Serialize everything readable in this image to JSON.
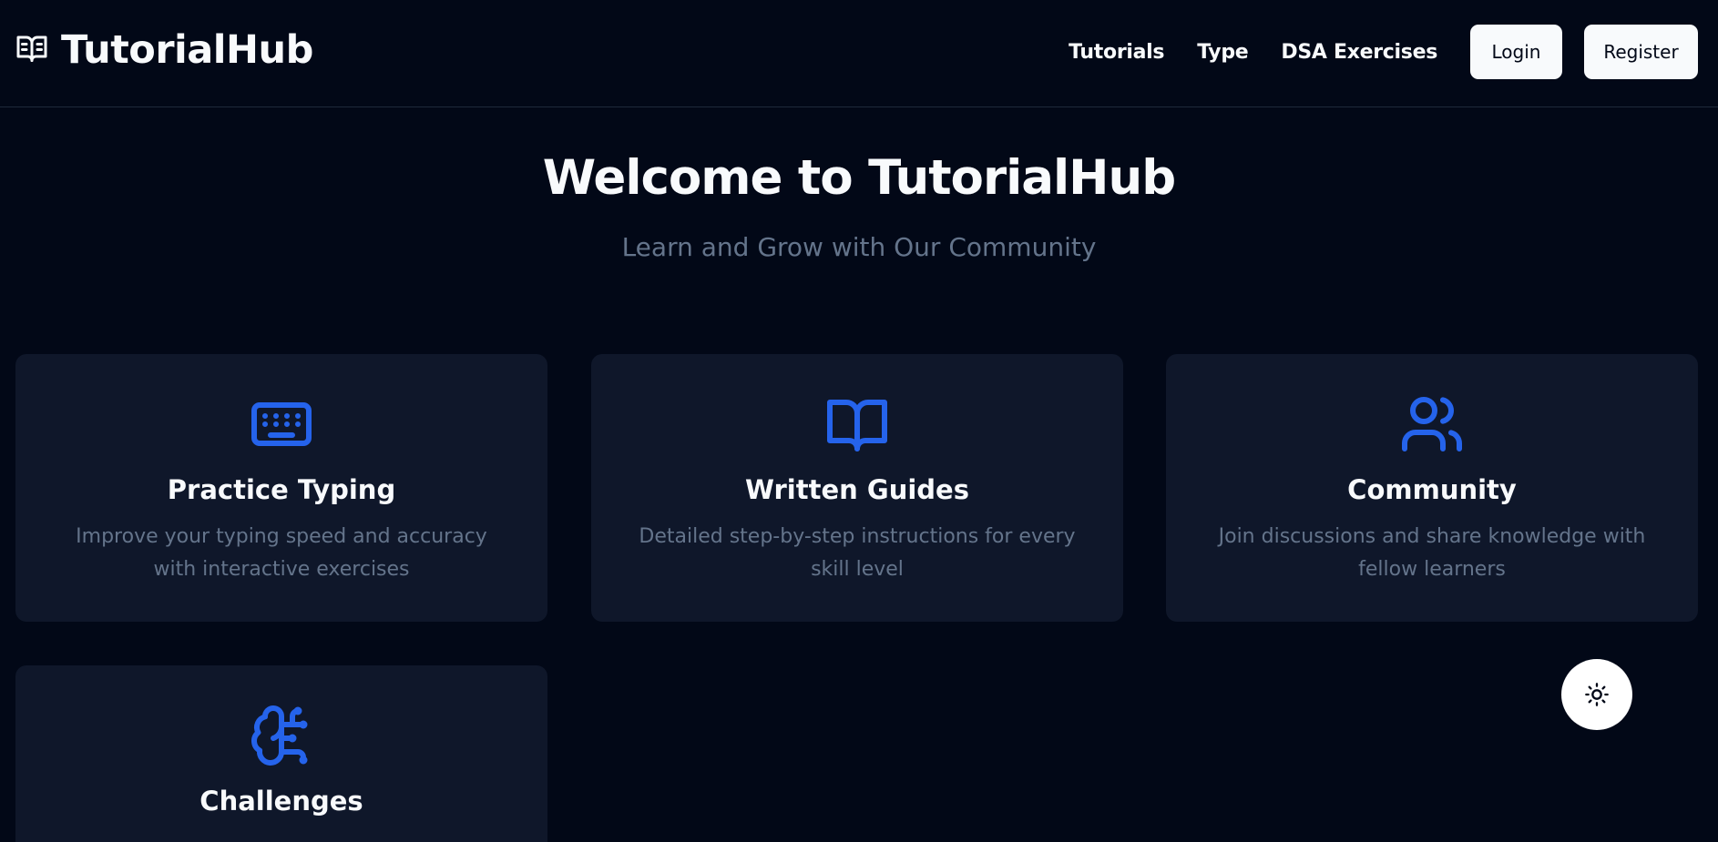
{
  "brand": {
    "icon": "book-open-icon",
    "name": "TutorialHub"
  },
  "nav": {
    "links": [
      "Tutorials",
      "Type",
      "DSA Exercises"
    ],
    "login_label": "Login",
    "register_label": "Register"
  },
  "hero": {
    "title": "Welcome to TutorialHub",
    "subtitle": "Learn and Grow with Our Community"
  },
  "features": [
    {
      "icon": "keyboard-icon",
      "title": "Practice Typing",
      "description": "Improve your typing speed and accuracy with interactive exercises"
    },
    {
      "icon": "book-open-icon",
      "title": "Written Guides",
      "description": "Detailed step-by-step instructions for every skill level"
    },
    {
      "icon": "users-icon",
      "title": "Community",
      "description": "Join discussions and share knowledge with fellow learners"
    },
    {
      "icon": "brain-circuit-icon",
      "title": "Challenges",
      "description": ""
    }
  ],
  "theme_toggle": {
    "icon": "sun-icon"
  },
  "colors": {
    "background": "#020817",
    "card": "#0f172a",
    "accent": "#2563eb",
    "muted_text": "#64748b",
    "foreground": "#f8fafc"
  }
}
